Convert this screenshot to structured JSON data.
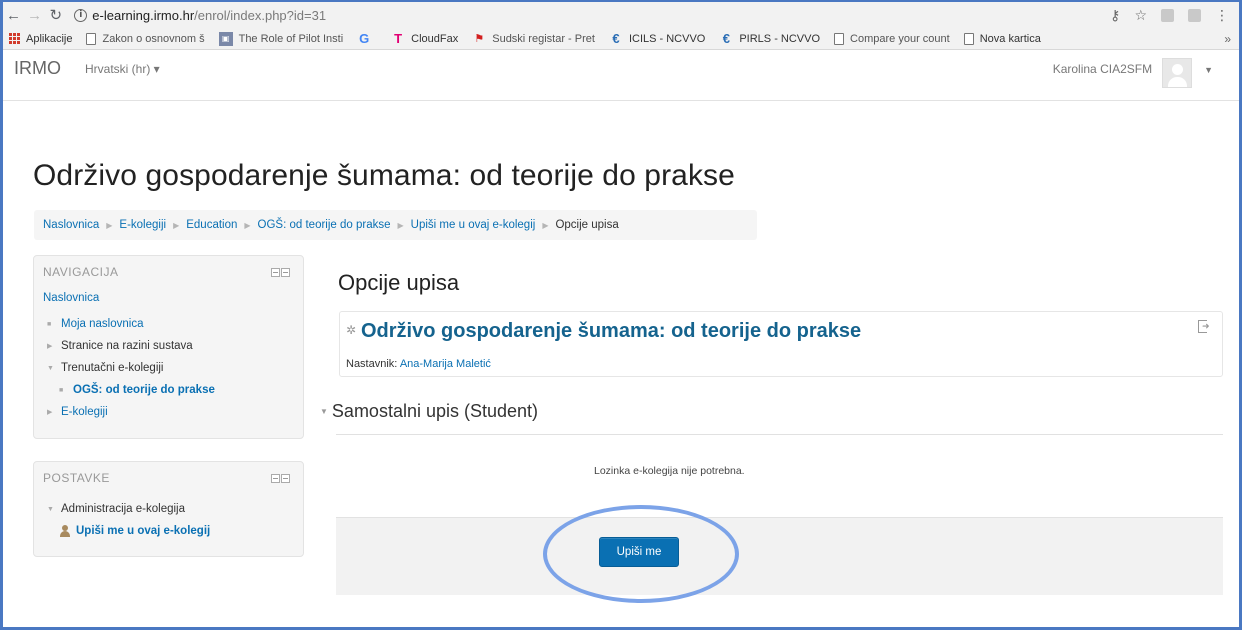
{
  "browser": {
    "url_host": "e-learning.irmo.hr",
    "url_path": "/enrol/index.php?id=31",
    "bookmarks": [
      {
        "label": "Aplikacije",
        "icon": "apps-grid-icon"
      },
      {
        "label": "Zakon o osnovnom š",
        "icon": "page-icon"
      },
      {
        "label": "The Role of Pilot Insti",
        "icon": "monitor-icon"
      },
      {
        "label": "",
        "icon": "google-icon"
      },
      {
        "label": "CloudFax",
        "icon": "telekom-icon"
      },
      {
        "label": "Sudski registar - Pret",
        "icon": "flag-icon"
      },
      {
        "label": "ICILS - NCVVO",
        "icon": "ncvvo-icon"
      },
      {
        "label": "PIRLS - NCVVO",
        "icon": "ncvvo-icon"
      },
      {
        "label": "Compare your count",
        "icon": "page-icon"
      },
      {
        "label": "Nova kartica",
        "icon": "page-icon"
      }
    ],
    "more_label": "»"
  },
  "navbar": {
    "brand": "IRMO",
    "language": "Hrvatski (hr) ▾",
    "user_name": "Karolina CIA2SFM"
  },
  "page": {
    "title": "Održivo gospodarenje šumama: od teorije do prakse",
    "breadcrumb": [
      "Naslovnica",
      "E-kolegiji",
      "Education",
      "OGŠ: od teorije do prakse",
      "Upiši me u ovaj e-kolegij",
      "Opcije upisa"
    ]
  },
  "nav_block": {
    "title": "NAVIGACIJA",
    "home": "Naslovnica",
    "my_home": "Moja naslovnica",
    "site_pages": "Stranice na razini sustava",
    "current_courses": "Trenutačni e-kolegiji",
    "current_course": "OGŠ: od teorije do prakse",
    "courses": "E-kolegiji"
  },
  "settings_block": {
    "title": "POSTAVKE",
    "admin": "Administracija e-kolegija",
    "enrol_me": "Upiši me u ovaj e-kolegij"
  },
  "main": {
    "heading": "Opcije upisa",
    "course_title": "Održivo gospodarenje šumama: od teorije do prakse",
    "teacher_label": "Nastavnik:",
    "teacher_name": "Ana-Marija Maletić",
    "section": "Samostalni upis (Student)",
    "no_key": "Lozinka e-kolegija nije potrebna.",
    "enrol_button": "Upiši me"
  },
  "colors": {
    "link": "#0a70b3",
    "course_title": "#15638e",
    "button": "#0a70b3",
    "highlight": "#7ca3e8"
  }
}
